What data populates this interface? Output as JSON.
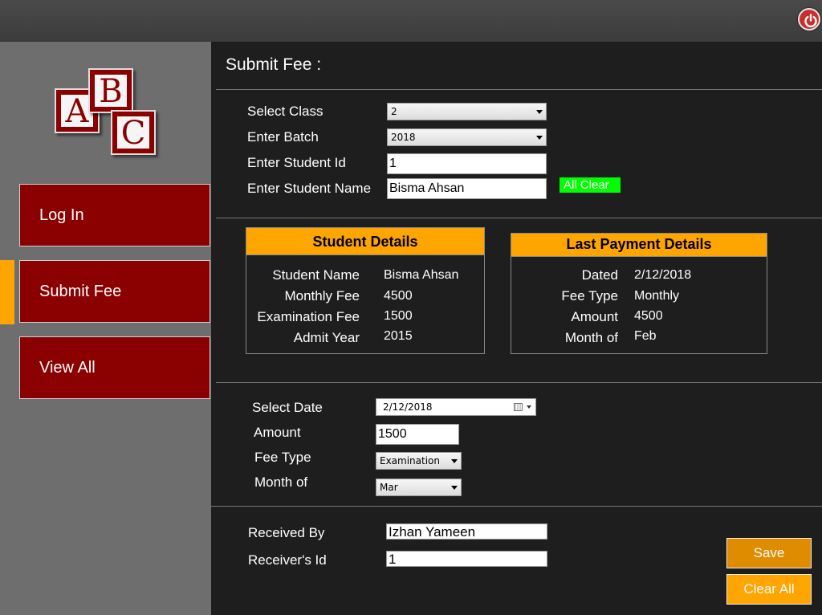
{
  "window": {
    "power_icon": "power-icon"
  },
  "logo": {
    "letters": [
      "A",
      "B",
      "C"
    ]
  },
  "sidebar": {
    "items": [
      {
        "label": "Log In"
      },
      {
        "label": "Submit Fee",
        "active": true
      },
      {
        "label": "View All"
      }
    ]
  },
  "page": {
    "title": "Submit Fee :"
  },
  "lookup": {
    "class_label": "Select Class",
    "class_value": "2",
    "batch_label": "Enter Batch",
    "batch_value": "2018",
    "student_id_label": "Enter Student Id",
    "student_id_value": "1",
    "student_name_label": "Enter Student Name",
    "student_name_value": "Bisma Ahsan",
    "all_clear_label": "All Clear"
  },
  "student_details": {
    "title": "Student Details",
    "rows": [
      {
        "label": "Student Name",
        "value": "Bisma Ahsan"
      },
      {
        "label": "Monthly Fee",
        "value": "4500"
      },
      {
        "label": "Examination Fee",
        "value": "1500"
      },
      {
        "label": "Admit Year",
        "value": "2015"
      }
    ]
  },
  "last_payment": {
    "title": "Last Payment Details",
    "rows": [
      {
        "label": "Dated",
        "value": "2/12/2018"
      },
      {
        "label": "Fee Type",
        "value": "Monthly"
      },
      {
        "label": "Amount",
        "value": "4500"
      },
      {
        "label": "Month of",
        "value": "Feb"
      }
    ]
  },
  "payment": {
    "date_label": "Select Date",
    "date_value": "2/12/2018",
    "amount_label": "Amount",
    "amount_value": "1500",
    "fee_type_label": "Fee Type",
    "fee_type_value": "Examination",
    "month_label": "Month of",
    "month_value": "Mar"
  },
  "receiver": {
    "received_by_label": "Received By",
    "received_by_value": "Izhan Yameen",
    "receiver_id_label": "Receiver's Id",
    "receiver_id_value": "1"
  },
  "actions": {
    "save_label": "Save",
    "clear_all_label": "Clear All"
  },
  "colors": {
    "accent": "#ffa500",
    "nav_button": "#8b0000",
    "all_clear": "#00ff00",
    "background": "#1e1e1e",
    "sidebar": "#6e6e6e"
  }
}
